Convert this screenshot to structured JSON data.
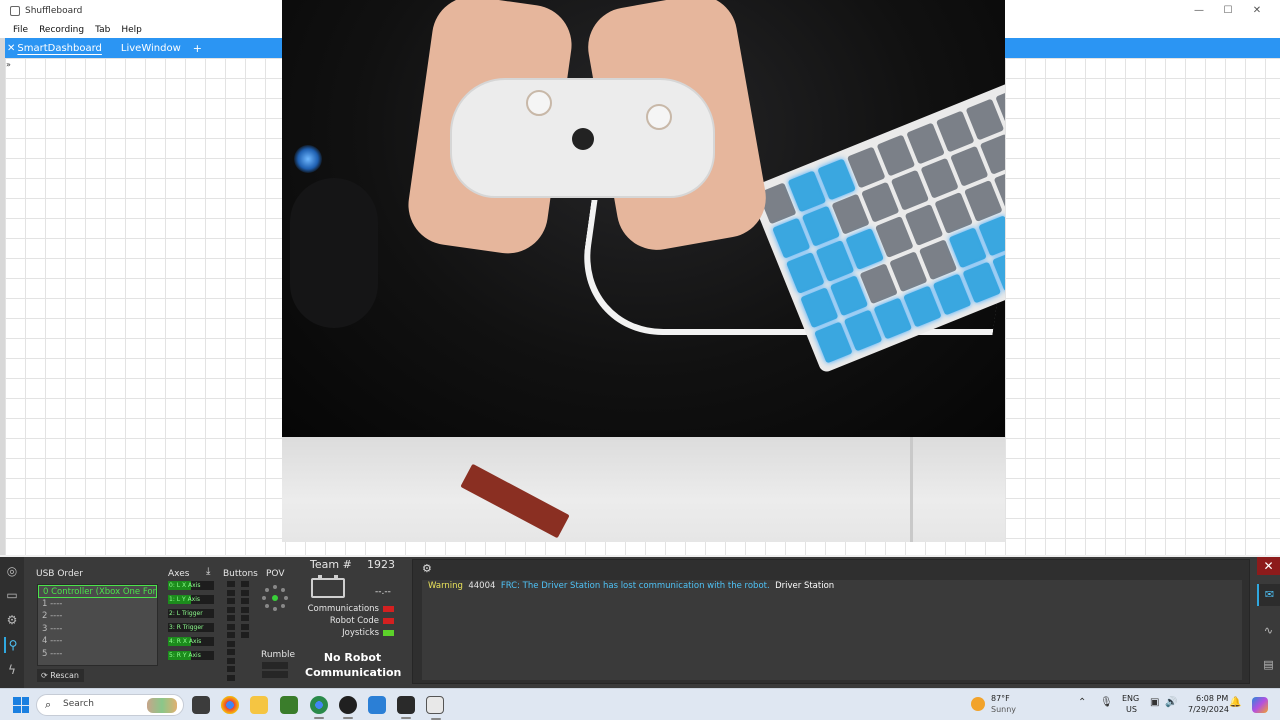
{
  "window": {
    "title": "Shuffleboard",
    "minimize": "—",
    "maximize": "☐",
    "close": "✕"
  },
  "menu": [
    "File",
    "Recording",
    "Tab",
    "Help"
  ],
  "tabs": {
    "close_glyph": "✕",
    "active": "SmartDashboard",
    "second": "LiveWindow",
    "add": "+"
  },
  "grid": {
    "expander": "»"
  },
  "driver_station": {
    "usb_order_label": "USB Order",
    "usb_devices": [
      "0  Controller (Xbox One For",
      "1  ----",
      "2  ----",
      "3  ----",
      "4  ----",
      "5  ----"
    ],
    "rescan_label": "Rescan",
    "axes_label": "Axes",
    "axes": [
      {
        "label": "0: L X Axis",
        "value": 0.5
      },
      {
        "label": "1: L Y Axis",
        "value": 0.5
      },
      {
        "label": "2: L Trigger",
        "value": 0.0
      },
      {
        "label": "3: R Trigger",
        "value": 0.0
      },
      {
        "label": "4: R X Axis",
        "value": 0.5
      },
      {
        "label": "5: R Y Axis",
        "value": 0.5
      }
    ],
    "buttons_label": "Buttons",
    "pov_label": "POV",
    "rumble_label": "Rumble",
    "team_label": "Team #",
    "team_number": "1923",
    "voltage": "--.--",
    "statuses": [
      {
        "label": "Communications",
        "color": "#d42020"
      },
      {
        "label": "Robot Code",
        "color": "#d42020"
      },
      {
        "label": "Joysticks",
        "color": "#5cd12a"
      }
    ],
    "robot_status": "No Robot Communication",
    "message": {
      "level": "Warning",
      "code": "44004",
      "text": "FRC: The Driver Station has lost communication with the robot.",
      "source": "Driver Station"
    },
    "close_glyph": "✕"
  },
  "taskbar": {
    "search_placeholder": "Search",
    "weather_temp": "87°F",
    "weather_condition": "Sunny",
    "lang": "ENG",
    "region": "US",
    "time": "6:08 PM",
    "date": "7/29/2024"
  }
}
